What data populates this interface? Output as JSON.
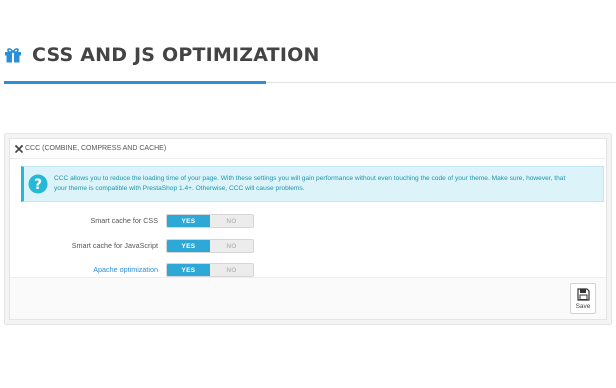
{
  "section": {
    "title": "CSS AND JS OPTIMIZATION",
    "icon": "gift-icon"
  },
  "panel": {
    "heading": "CCC (COMBINE, COMPRESS AND CACHE)",
    "heading_icon": "tools-icon",
    "info": {
      "icon": "info-icon",
      "line1": "CCC allows you to reduce the loading time of your page. With these settings you will gain performance without even touching the code of your theme. Make sure, however, that",
      "line2": "your theme is compatible with PrestaShop 1.4+. Otherwise, CCC will cause problems."
    },
    "settings": [
      {
        "label": "Smart cache for CSS",
        "yes": "YES",
        "no": "NO",
        "value": "YES"
      },
      {
        "label": "Smart cache for JavaScript",
        "yes": "YES",
        "no": "NO",
        "value": "YES"
      },
      {
        "label": "Apache optimization",
        "yes": "YES",
        "no": "NO",
        "value": "YES"
      }
    ],
    "footer": {
      "save_label": "Save",
      "save_icon": "save-icon"
    }
  },
  "colors": {
    "accent": "#2e8ed6",
    "toggle_on": "#2ea8d6",
    "info_bg": "#dcf4f9",
    "info_text": "#1e94ab"
  }
}
